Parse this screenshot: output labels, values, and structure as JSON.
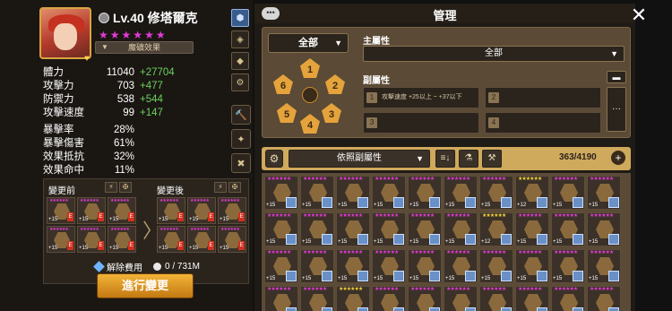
{
  "hero": {
    "level_name": "Lv.40 修塔爾克",
    "stars": [
      "★",
      "★",
      "★",
      "★",
      "★",
      "★"
    ],
    "heart": "♥",
    "rune_effect_label": "魔礦效果",
    "rune_effect_arrow": "▼"
  },
  "stats": [
    {
      "name": "體力",
      "value": "11040",
      "bonus": "+27704"
    },
    {
      "name": "攻擊力",
      "value": "703",
      "bonus": "+477"
    },
    {
      "name": "防禦力",
      "value": "538",
      "bonus": "+544"
    },
    {
      "name": "攻擊速度",
      "value": "99",
      "bonus": "+147"
    }
  ],
  "stats2": [
    {
      "name": "暴擊率",
      "value": "28%"
    },
    {
      "name": "暴擊傷害",
      "value": "61%"
    },
    {
      "name": "效果抵抗",
      "value": "32%"
    },
    {
      "name": "效果命中",
      "value": "11%"
    }
  ],
  "compare": {
    "before_label": "變更前",
    "after_label": "變更後",
    "arrow": "〉",
    "level": "+15",
    "tag": "E"
  },
  "cost": {
    "label": "解除費用",
    "value": "0 / 731M"
  },
  "apply_button": "進行變更",
  "manager": {
    "title": "管理",
    "chat_icon": "•••",
    "close_icon": "✕",
    "all_dropdown": "全部",
    "main_attr_label": "主屬性",
    "main_attr_value": "全部",
    "sub_attr_label": "副屬性",
    "sub_slots": [
      {
        "num": "1",
        "text": "攻擊速度 +25以上 ~ +37以下"
      },
      {
        "num": "2",
        "text": ""
      },
      {
        "num": "3",
        "text": ""
      },
      {
        "num": "4",
        "text": ""
      }
    ],
    "set_numbers": [
      "1",
      "2",
      "3",
      "4",
      "5",
      "6"
    ],
    "more": "···",
    "toggle": "▬"
  },
  "inventory": {
    "sort_label": "依照副屬性",
    "count": "363/4190",
    "add": "+",
    "runes": [
      {
        "lv": "+15",
        "stars": "★★★★★★",
        "gold": false
      },
      {
        "lv": "+15",
        "stars": "★★★★★★",
        "gold": false
      },
      {
        "lv": "+15",
        "stars": "★★★★★★",
        "gold": false
      },
      {
        "lv": "+15",
        "stars": "★★★★★★",
        "gold": false
      },
      {
        "lv": "+15",
        "stars": "★★★★★★",
        "gold": false
      },
      {
        "lv": "+15",
        "stars": "★★★★★★",
        "gold": false
      },
      {
        "lv": "+15",
        "stars": "★★★★★★",
        "gold": false
      },
      {
        "lv": "+12",
        "stars": "★★★★★★",
        "gold": true
      },
      {
        "lv": "+15",
        "stars": "★★★★★★",
        "gold": false
      },
      {
        "lv": "+15",
        "stars": "★★★★★★",
        "gold": false
      },
      {
        "lv": "+15",
        "stars": "★★★★★★",
        "gold": false
      },
      {
        "lv": "+15",
        "stars": "★★★★★★",
        "gold": false
      },
      {
        "lv": "+15",
        "stars": "★★★★★★",
        "gold": false
      },
      {
        "lv": "+15",
        "stars": "★★★★★★",
        "gold": false
      },
      {
        "lv": "+15",
        "stars": "★★★★★★",
        "gold": false
      },
      {
        "lv": "+15",
        "stars": "★★★★★★",
        "gold": false
      },
      {
        "lv": "+12",
        "stars": "★★★★★★",
        "gold": true
      },
      {
        "lv": "+15",
        "stars": "★★★★★★",
        "gold": false
      },
      {
        "lv": "+15",
        "stars": "★★★★★★",
        "gold": false
      },
      {
        "lv": "+15",
        "stars": "★★★★★★",
        "gold": false
      },
      {
        "lv": "+15",
        "stars": "★★★★★★",
        "gold": false
      },
      {
        "lv": "+15",
        "stars": "★★★★★★",
        "gold": false
      },
      {
        "lv": "+15",
        "stars": "★★★★★★",
        "gold": false
      },
      {
        "lv": "+15",
        "stars": "★★★★★★",
        "gold": false
      },
      {
        "lv": "+15",
        "stars": "★★★★★★",
        "gold": false
      },
      {
        "lv": "+15",
        "stars": "★★★★★★",
        "gold": false
      },
      {
        "lv": "+15",
        "stars": "★★★★★★",
        "gold": false
      },
      {
        "lv": "+15",
        "stars": "★★★★★★",
        "gold": false
      },
      {
        "lv": "+15",
        "stars": "★★★★★★",
        "gold": false
      },
      {
        "lv": "+15",
        "stars": "★★★★★★",
        "gold": false
      },
      {
        "lv": "",
        "stars": "★★★★★★",
        "gold": false
      },
      {
        "lv": "",
        "stars": "★★★★★★",
        "gold": false
      },
      {
        "lv": "",
        "stars": "★★★★★★",
        "gold": true
      },
      {
        "lv": "",
        "stars": "★★★★★★",
        "gold": false
      },
      {
        "lv": "",
        "stars": "★★★★★★",
        "gold": false
      },
      {
        "lv": "",
        "stars": "★★★★★★",
        "gold": false
      },
      {
        "lv": "",
        "stars": "★★★★★★",
        "gold": false
      },
      {
        "lv": "",
        "stars": "★★★★★★",
        "gold": false
      },
      {
        "lv": "",
        "stars": "★★★★★★",
        "gold": false
      },
      {
        "lv": "",
        "stars": "★★★★★★",
        "gold": false
      }
    ]
  },
  "colors": {
    "accent": "#e5a33c",
    "star": "#e13bd4",
    "bonus": "#6bd25d"
  }
}
